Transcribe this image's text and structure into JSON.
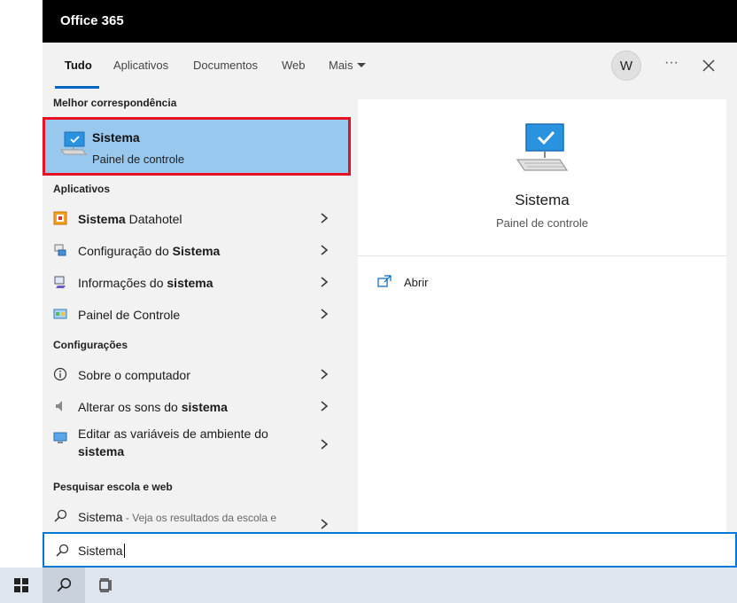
{
  "app": {
    "title": "Office 365"
  },
  "tabs": [
    {
      "label": "Tudo"
    },
    {
      "label": "Aplicativos"
    },
    {
      "label": "Documentos"
    },
    {
      "label": "Web"
    },
    {
      "label": "Mais"
    }
  ],
  "header": {
    "avatar_initial": "W",
    "more_label": "···"
  },
  "sections": {
    "best_match": "Melhor correspondência",
    "apps": "Aplicativos",
    "settings": "Configurações",
    "web": "Pesquisar escola e web"
  },
  "best_match": {
    "name": "Sistema",
    "subtitle": "Painel de controle"
  },
  "apps": [
    {
      "bold": "Sistema",
      "rest": " Datahotel"
    },
    {
      "before": "Configuração do ",
      "bold": "Sistema"
    },
    {
      "before": "Informações do ",
      "bold": "sistema"
    },
    {
      "text": "Painel de Controle"
    }
  ],
  "settings": [
    {
      "text": "Sobre o computador"
    },
    {
      "before": "Alterar os sons do ",
      "bold": "sistema"
    },
    {
      "before": "Editar as variáveis de ambiente do ",
      "bold": "sistema"
    }
  ],
  "web_results": [
    {
      "text": "Sistema",
      "muted": " - Veja os resultados da escola e"
    }
  ],
  "preview": {
    "name": "Sistema",
    "subtitle": "Painel de controle",
    "action_open": "Abrir"
  },
  "search": {
    "value": "Sistema"
  },
  "colors": {
    "accent": "#0067c0",
    "highlight": "#99c8ee",
    "selection_border": "#e81123",
    "titlebar": "#000000"
  }
}
